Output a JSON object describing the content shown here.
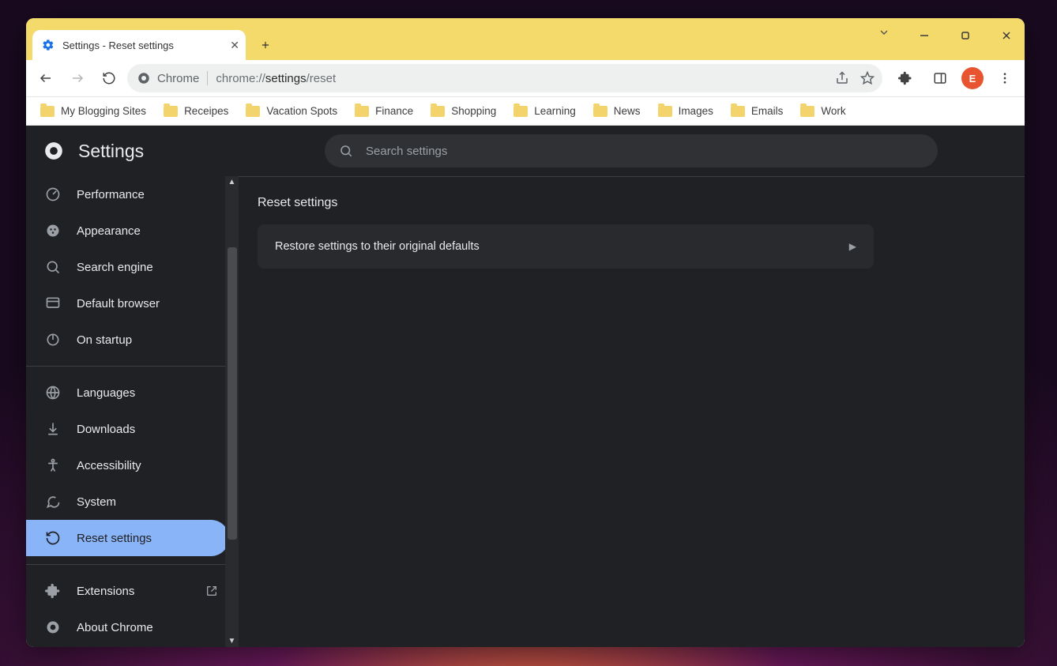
{
  "tab": {
    "title": "Settings - Reset settings"
  },
  "omnibox": {
    "chip": "Chrome",
    "url_prefix": "chrome://",
    "url_mid": "settings",
    "url_suffix": "/reset"
  },
  "bookmarks": [
    "My Blogging Sites",
    "Receipes",
    "Vacation Spots",
    "Finance",
    "Shopping",
    "Learning",
    "News",
    "Images",
    "Emails",
    "Work"
  ],
  "avatar_letter": "E",
  "settings": {
    "title": "Settings",
    "search_placeholder": "Search settings",
    "nav_group1": [
      "Performance",
      "Appearance",
      "Search engine",
      "Default browser",
      "On startup"
    ],
    "nav_group2": [
      "Languages",
      "Downloads",
      "Accessibility",
      "System",
      "Reset settings"
    ],
    "nav_group3": [
      "Extensions",
      "About Chrome"
    ],
    "active": "Reset settings"
  },
  "main": {
    "heading": "Reset settings",
    "card_label": "Restore settings to their original defaults"
  }
}
